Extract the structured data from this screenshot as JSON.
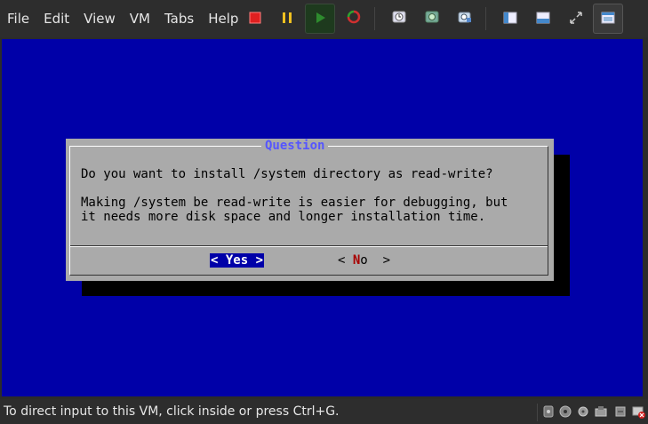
{
  "menu": {
    "file": "File",
    "edit": "Edit",
    "view": "View",
    "vm": "VM",
    "tabs": "Tabs",
    "help": "Help"
  },
  "toolbar": {
    "icons": [
      "power-off-icon",
      "pause-icon",
      "play-icon",
      "restart-icon",
      "snapshot-icon",
      "revert-snapshot-icon",
      "manage-snapshots-icon",
      "sidebar-view-icon",
      "console-view-icon",
      "fullscreen-icon",
      "unity-icon"
    ],
    "colors": {
      "stop": "#e02020",
      "pause": "#f0c020",
      "play": "#2e8b2e",
      "restart": "#d03030"
    }
  },
  "dialog": {
    "title": "Question",
    "line1": "Do you want to install /system directory as read-write?",
    "line2": "Making /system be read-write is easier for debugging, but",
    "line3": "it needs more disk space and longer installation time.",
    "yes": {
      "left": "< ",
      "label": "Yes",
      "right": " >"
    },
    "no": {
      "left": "< ",
      "hot": "N",
      "rest": "o",
      "right": "  >"
    }
  },
  "status": {
    "text": "To direct input to this VM, click inside or press Ctrl+G."
  },
  "colors": {
    "console_bg": "#0000a8",
    "dialog_bg": "#aaaaaa",
    "title_color": "#5555ff",
    "hotkey": "#a80000"
  }
}
